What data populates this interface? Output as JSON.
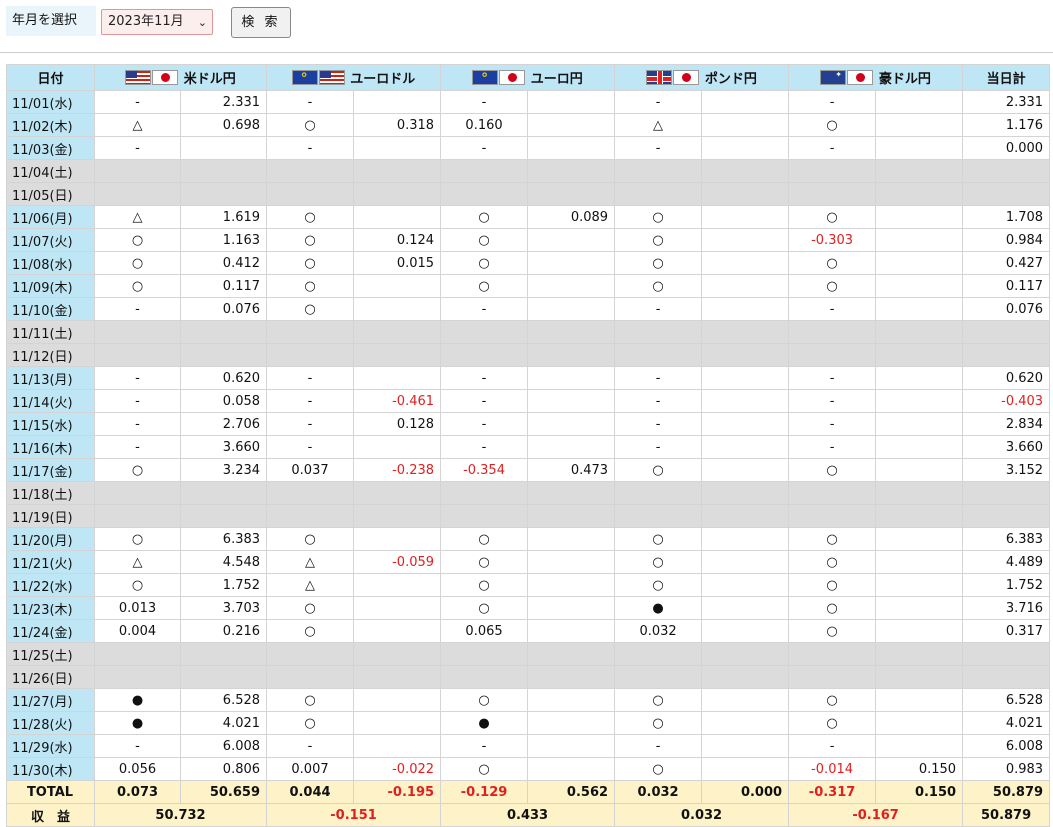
{
  "search": {
    "label": "年月を選択",
    "selected_month": "2023年11月",
    "button_label": "検 索"
  },
  "table": {
    "headers": {
      "date": "日付",
      "usdjpy": "米ドル円",
      "eurusd": "ユーロドル",
      "eurjpy": "ユーロ円",
      "gbpjpy": "ポンド円",
      "audjpy": "豪ドル円",
      "daily_total": "当日計"
    },
    "rows": [
      {
        "date": "11/01(水)",
        "weekend": false,
        "cells": [
          "-",
          "2.331",
          "-",
          "",
          "-",
          "",
          "-",
          "",
          "-",
          "",
          "2.331"
        ]
      },
      {
        "date": "11/02(木)",
        "weekend": false,
        "cells": [
          "△",
          "0.698",
          "○",
          "0.318",
          "0.160",
          "",
          "△",
          "",
          "○",
          "",
          "1.176"
        ]
      },
      {
        "date": "11/03(金)",
        "weekend": false,
        "cells": [
          "-",
          "",
          "-",
          "",
          "-",
          "",
          "-",
          "",
          "-",
          "",
          "0.000"
        ]
      },
      {
        "date": "11/04(土)",
        "weekend": true,
        "cells": [
          "",
          "",
          "",
          "",
          "",
          "",
          "",
          "",
          "",
          "",
          ""
        ]
      },
      {
        "date": "11/05(日)",
        "weekend": true,
        "cells": [
          "",
          "",
          "",
          "",
          "",
          "",
          "",
          "",
          "",
          "",
          ""
        ]
      },
      {
        "date": "11/06(月)",
        "weekend": false,
        "cells": [
          "△",
          "1.619",
          "○",
          "",
          "○",
          "0.089",
          "○",
          "",
          "○",
          "",
          "1.708"
        ]
      },
      {
        "date": "11/07(火)",
        "weekend": false,
        "cells": [
          "○",
          "1.163",
          "○",
          "0.124",
          "○",
          "",
          "○",
          "",
          "-0.303",
          "",
          "0.984"
        ]
      },
      {
        "date": "11/08(水)",
        "weekend": false,
        "cells": [
          "○",
          "0.412",
          "○",
          "0.015",
          "○",
          "",
          "○",
          "",
          "○",
          "",
          "0.427"
        ]
      },
      {
        "date": "11/09(木)",
        "weekend": false,
        "cells": [
          "○",
          "0.117",
          "○",
          "",
          "○",
          "",
          "○",
          "",
          "○",
          "",
          "0.117"
        ]
      },
      {
        "date": "11/10(金)",
        "weekend": false,
        "cells": [
          "-",
          "0.076",
          "○",
          "",
          "-",
          "",
          "-",
          "",
          "-",
          "",
          "0.076"
        ]
      },
      {
        "date": "11/11(土)",
        "weekend": true,
        "cells": [
          "",
          "",
          "",
          "",
          "",
          "",
          "",
          "",
          "",
          "",
          ""
        ]
      },
      {
        "date": "11/12(日)",
        "weekend": true,
        "cells": [
          "",
          "",
          "",
          "",
          "",
          "",
          "",
          "",
          "",
          "",
          ""
        ]
      },
      {
        "date": "11/13(月)",
        "weekend": false,
        "cells": [
          "-",
          "0.620",
          "-",
          "",
          "-",
          "",
          "-",
          "",
          "-",
          "",
          "0.620"
        ]
      },
      {
        "date": "11/14(火)",
        "weekend": false,
        "cells": [
          "-",
          "0.058",
          "-",
          "-0.461",
          "-",
          "",
          "-",
          "",
          "-",
          "",
          "-0.403"
        ]
      },
      {
        "date": "11/15(水)",
        "weekend": false,
        "cells": [
          "-",
          "2.706",
          "-",
          "0.128",
          "-",
          "",
          "-",
          "",
          "-",
          "",
          "2.834"
        ]
      },
      {
        "date": "11/16(木)",
        "weekend": false,
        "cells": [
          "-",
          "3.660",
          "-",
          "",
          "-",
          "",
          "-",
          "",
          "-",
          "",
          "3.660"
        ]
      },
      {
        "date": "11/17(金)",
        "weekend": false,
        "cells": [
          "○",
          "3.234",
          "0.037",
          "-0.238",
          "-0.354",
          "0.473",
          "○",
          "",
          "○",
          "",
          "3.152"
        ]
      },
      {
        "date": "11/18(土)",
        "weekend": true,
        "cells": [
          "",
          "",
          "",
          "",
          "",
          "",
          "",
          "",
          "",
          "",
          ""
        ]
      },
      {
        "date": "11/19(日)",
        "weekend": true,
        "cells": [
          "",
          "",
          "",
          "",
          "",
          "",
          "",
          "",
          "",
          "",
          ""
        ]
      },
      {
        "date": "11/20(月)",
        "weekend": false,
        "cells": [
          "○",
          "6.383",
          "○",
          "",
          "○",
          "",
          "○",
          "",
          "○",
          "",
          "6.383"
        ]
      },
      {
        "date": "11/21(火)",
        "weekend": false,
        "cells": [
          "△",
          "4.548",
          "△",
          "-0.059",
          "○",
          "",
          "○",
          "",
          "○",
          "",
          "4.489"
        ]
      },
      {
        "date": "11/22(水)",
        "weekend": false,
        "cells": [
          "○",
          "1.752",
          "△",
          "",
          "○",
          "",
          "○",
          "",
          "○",
          "",
          "1.752"
        ]
      },
      {
        "date": "11/23(木)",
        "weekend": false,
        "cells": [
          "0.013",
          "3.703",
          "○",
          "",
          "○",
          "",
          "●",
          "",
          "○",
          "",
          "3.716"
        ]
      },
      {
        "date": "11/24(金)",
        "weekend": false,
        "cells": [
          "0.004",
          "0.216",
          "○",
          "",
          "0.065",
          "",
          "0.032",
          "",
          "○",
          "",
          "0.317"
        ]
      },
      {
        "date": "11/25(土)",
        "weekend": true,
        "cells": [
          "",
          "",
          "",
          "",
          "",
          "",
          "",
          "",
          "",
          "",
          ""
        ]
      },
      {
        "date": "11/26(日)",
        "weekend": true,
        "cells": [
          "",
          "",
          "",
          "",
          "",
          "",
          "",
          "",
          "",
          "",
          ""
        ]
      },
      {
        "date": "11/27(月)",
        "weekend": false,
        "cells": [
          "●",
          "6.528",
          "○",
          "",
          "○",
          "",
          "○",
          "",
          "○",
          "",
          "6.528"
        ]
      },
      {
        "date": "11/28(火)",
        "weekend": false,
        "cells": [
          "●",
          "4.021",
          "○",
          "",
          "●",
          "",
          "○",
          "",
          "○",
          "",
          "4.021"
        ]
      },
      {
        "date": "11/29(水)",
        "weekend": false,
        "cells": [
          "-",
          "6.008",
          "-",
          "",
          "-",
          "",
          "-",
          "",
          "-",
          "",
          "6.008"
        ]
      },
      {
        "date": "11/30(木)",
        "weekend": false,
        "cells": [
          "0.056",
          "0.806",
          "0.007",
          "-0.022",
          "○",
          "",
          "○",
          "",
          "-0.014",
          "0.150",
          "0.983"
        ]
      }
    ],
    "total": {
      "label": "TOTAL",
      "cells": [
        "0.073",
        "50.659",
        "0.044",
        "-0.195",
        "-0.129",
        "0.562",
        "0.032",
        "0.000",
        "-0.317",
        "0.150",
        "50.879"
      ]
    },
    "profit": {
      "label": "収　益",
      "cells": [
        "50.732",
        "-0.151",
        "0.433",
        "0.032",
        "-0.167",
        "50.879"
      ]
    }
  },
  "colors": {
    "header_bg": "#bfe6f5",
    "weekend_bg": "#dcdcdc",
    "total_bg": "#fdf2c8",
    "negative": "#e02020"
  }
}
